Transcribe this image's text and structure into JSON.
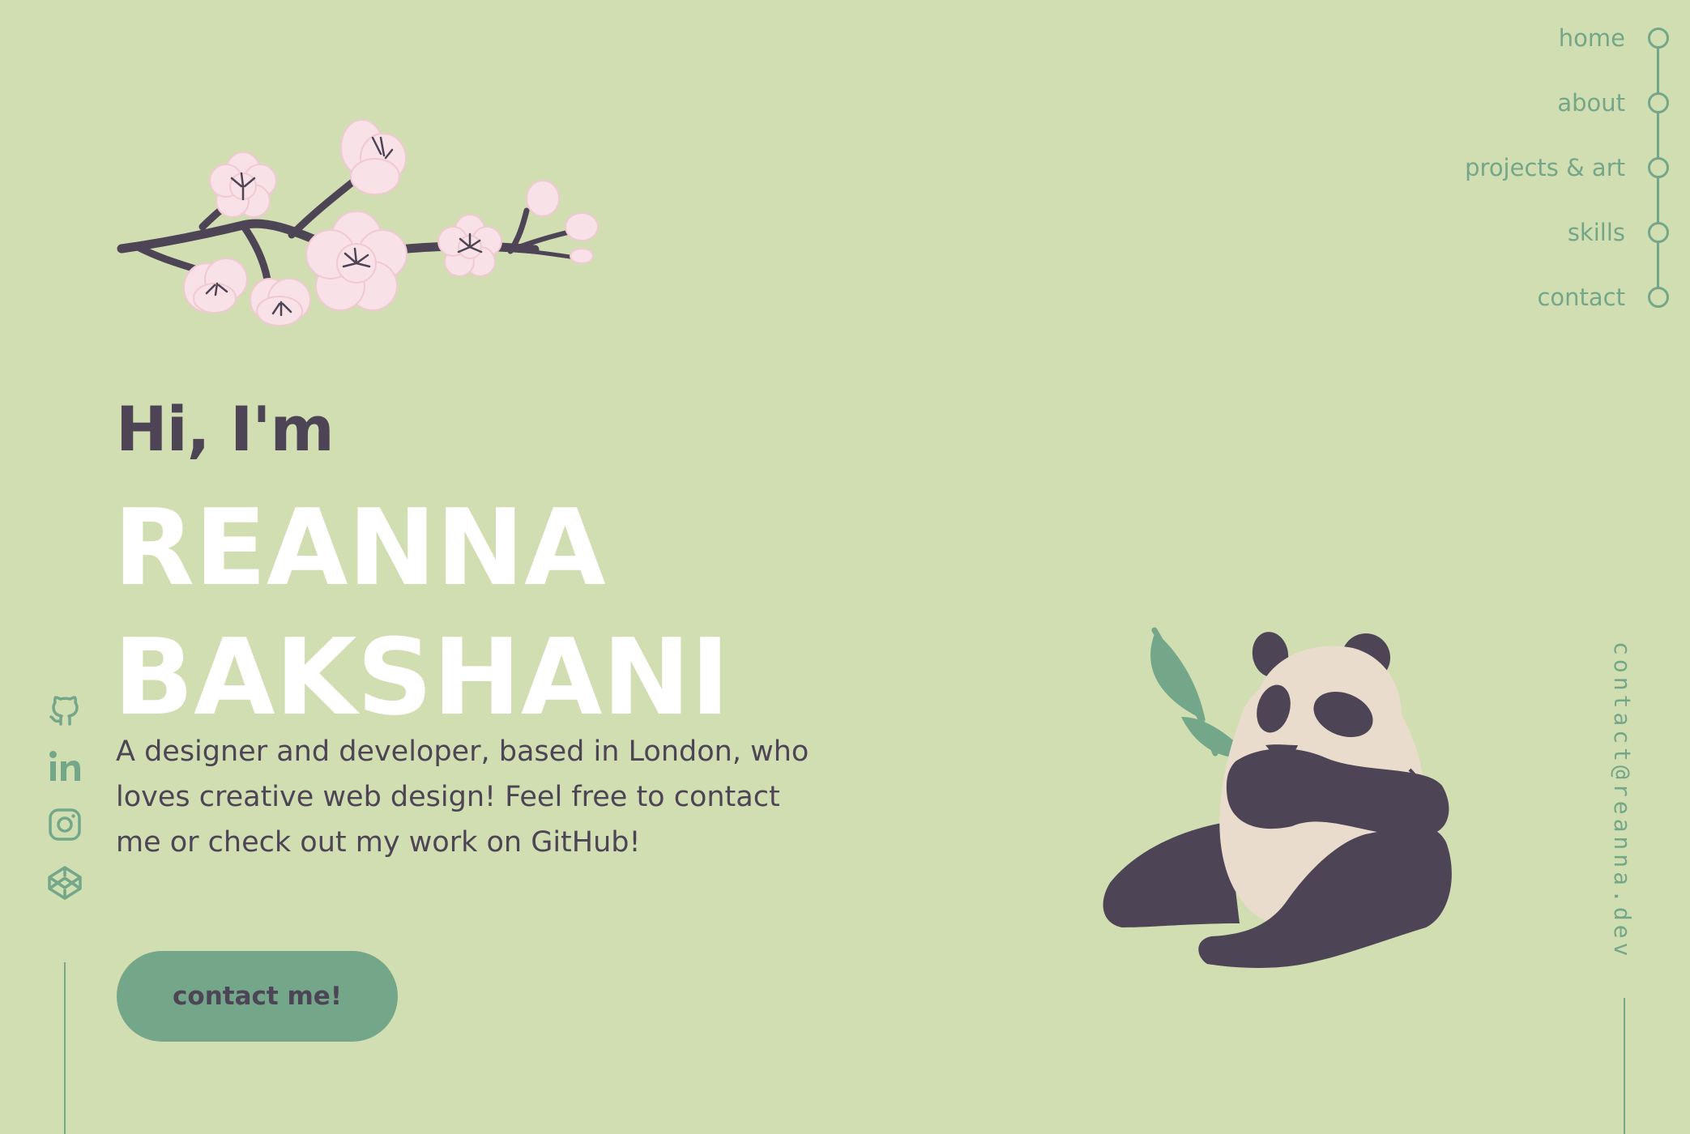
{
  "nav": {
    "items": [
      {
        "label": "home"
      },
      {
        "label": "about"
      },
      {
        "label": "projects & art"
      },
      {
        "label": "skills"
      },
      {
        "label": "contact"
      }
    ]
  },
  "hero": {
    "greeting": "Hi, I'm",
    "first_name": "REANNA",
    "last_name": "BAKSHANI",
    "intro": "A designer and developer, based in London, who loves creative web design! Feel free to contact me or check out my work on GitHub!",
    "cta_label": "contact me!"
  },
  "socials": [
    {
      "icon": "github-icon"
    },
    {
      "icon": "linkedin-icon"
    },
    {
      "icon": "instagram-icon"
    },
    {
      "icon": "codepen-icon"
    }
  ],
  "email": "contact@reanna.dev",
  "colors": {
    "background": "#d1deb1",
    "accent": "#74a68a",
    "text_dark": "#4d4455",
    "text_light": "#ffffff",
    "blossom": "#f8e1e7",
    "panda_body": "#e9dccc"
  }
}
